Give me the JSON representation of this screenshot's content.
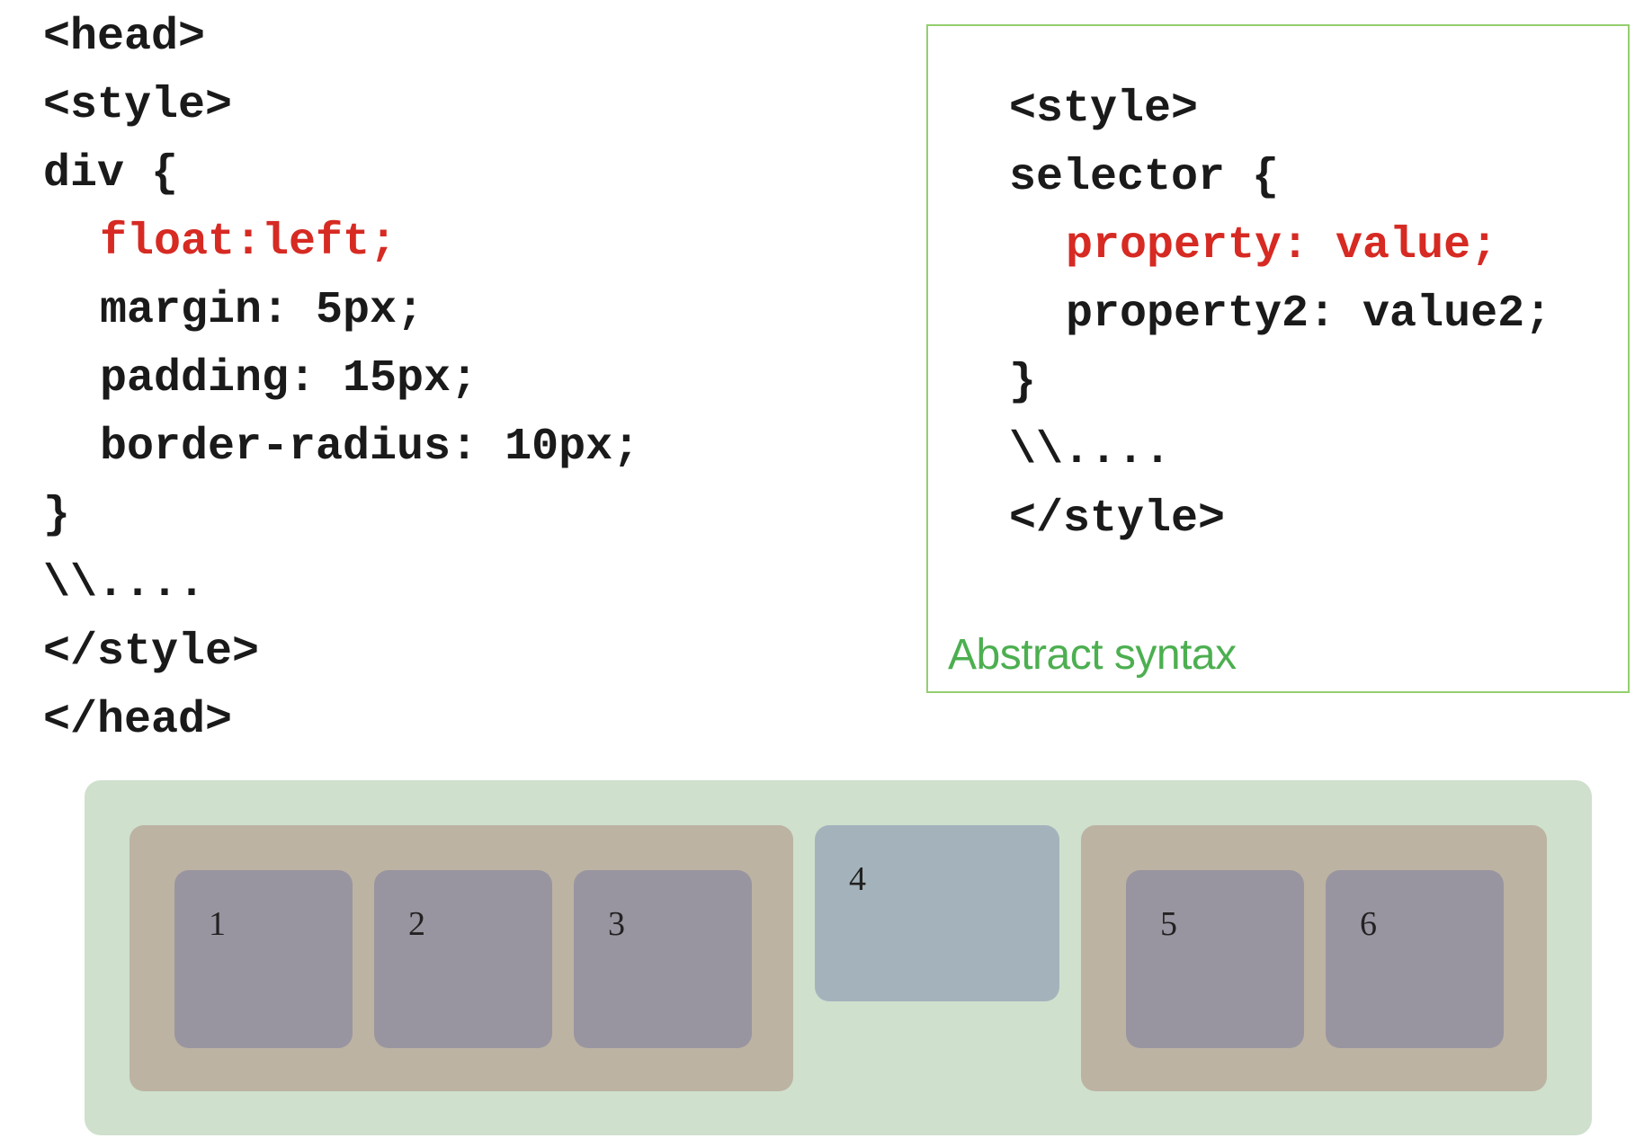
{
  "code": {
    "lines": [
      "<head>",
      "<style>",
      "div {",
      "float:left;",
      "margin: 5px;",
      "padding: 15px;",
      "border-radius: 10px;",
      "}",
      "\\\\....",
      "</style>",
      "</head>"
    ]
  },
  "syntax": {
    "lines": [
      "<style>",
      "selector {",
      "property: value;",
      "property2: value2;",
      "}",
      "\\\\....",
      "</style>"
    ],
    "caption": "Abstract syntax"
  },
  "demo": {
    "boxes": [
      "1",
      "2",
      "3",
      "4",
      "5",
      "6"
    ]
  },
  "colors": {
    "highlight": "#d62a23",
    "caption": "#4caf50",
    "box_border": "#94cf6f"
  }
}
